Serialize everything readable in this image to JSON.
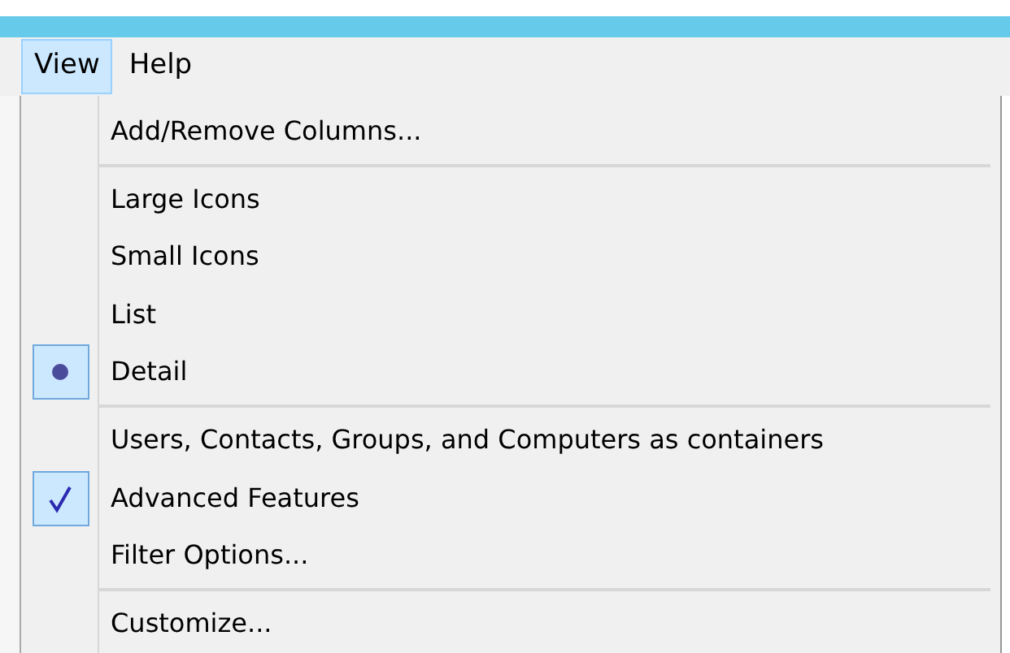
{
  "menubar": [
    {
      "label": "View",
      "selected": true
    },
    {
      "label": "Help",
      "selected": false
    }
  ],
  "menu": [
    {
      "kind": "command",
      "label": "Add/Remove Columns..."
    },
    {
      "kind": "separator"
    },
    {
      "kind": "radio",
      "label": "Large Icons",
      "checked": false
    },
    {
      "kind": "radio",
      "label": "Small Icons",
      "checked": false
    },
    {
      "kind": "radio",
      "label": "List",
      "checked": false
    },
    {
      "kind": "radio",
      "label": "Detail",
      "checked": true
    },
    {
      "kind": "separator"
    },
    {
      "kind": "check",
      "label": "Users, Contacts, Groups, and Computers as containers",
      "checked": false
    },
    {
      "kind": "check",
      "label": "Advanced Features",
      "checked": true
    },
    {
      "kind": "command",
      "label": "Filter Options..."
    },
    {
      "kind": "separator"
    },
    {
      "kind": "command",
      "label": "Customize..."
    }
  ]
}
